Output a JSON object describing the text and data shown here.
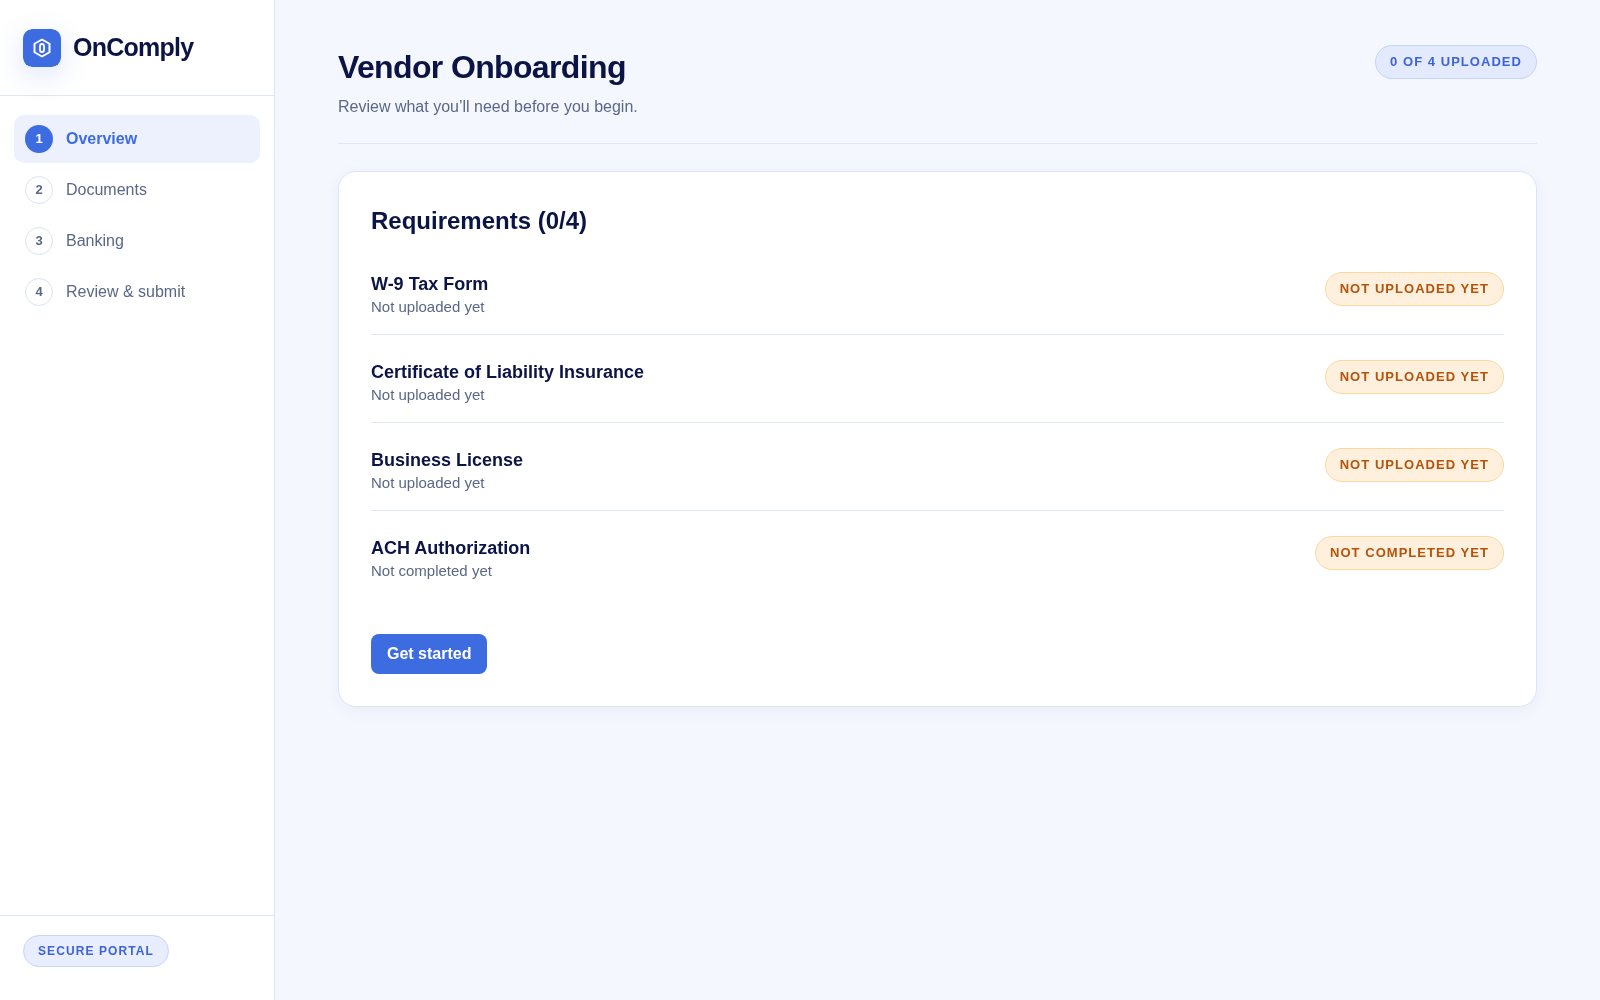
{
  "sidebar": {
    "brand": "OnComply",
    "steps": [
      {
        "number": "1",
        "label": "Overview",
        "selected": true
      },
      {
        "number": "2",
        "label": "Documents",
        "selected": false
      },
      {
        "number": "3",
        "label": "Banking",
        "selected": false
      },
      {
        "number": "4",
        "label": "Review & submit",
        "selected": false
      }
    ],
    "footer_badge": "SECURE PORTAL"
  },
  "header": {
    "title": "Vendor Onboarding",
    "subtitle": "Review what you’ll need before you begin.",
    "progress_badge": "0 OF 4 UPLOADED"
  },
  "requirements": {
    "title": "Requirements (0/4)",
    "items": [
      {
        "name": "W-9 Tax Form",
        "status": "Not uploaded yet",
        "badge": "NOT UPLOADED YET"
      },
      {
        "name": "Certificate of Liability Insurance",
        "status": "Not uploaded yet",
        "badge": "NOT UPLOADED YET"
      },
      {
        "name": "Business License",
        "status": "Not uploaded yet",
        "badge": "NOT UPLOADED YET"
      },
      {
        "name": "ACH Authorization",
        "status": "Not completed yet",
        "badge": "NOT COMPLETED YET"
      }
    ],
    "button": "Get started"
  }
}
